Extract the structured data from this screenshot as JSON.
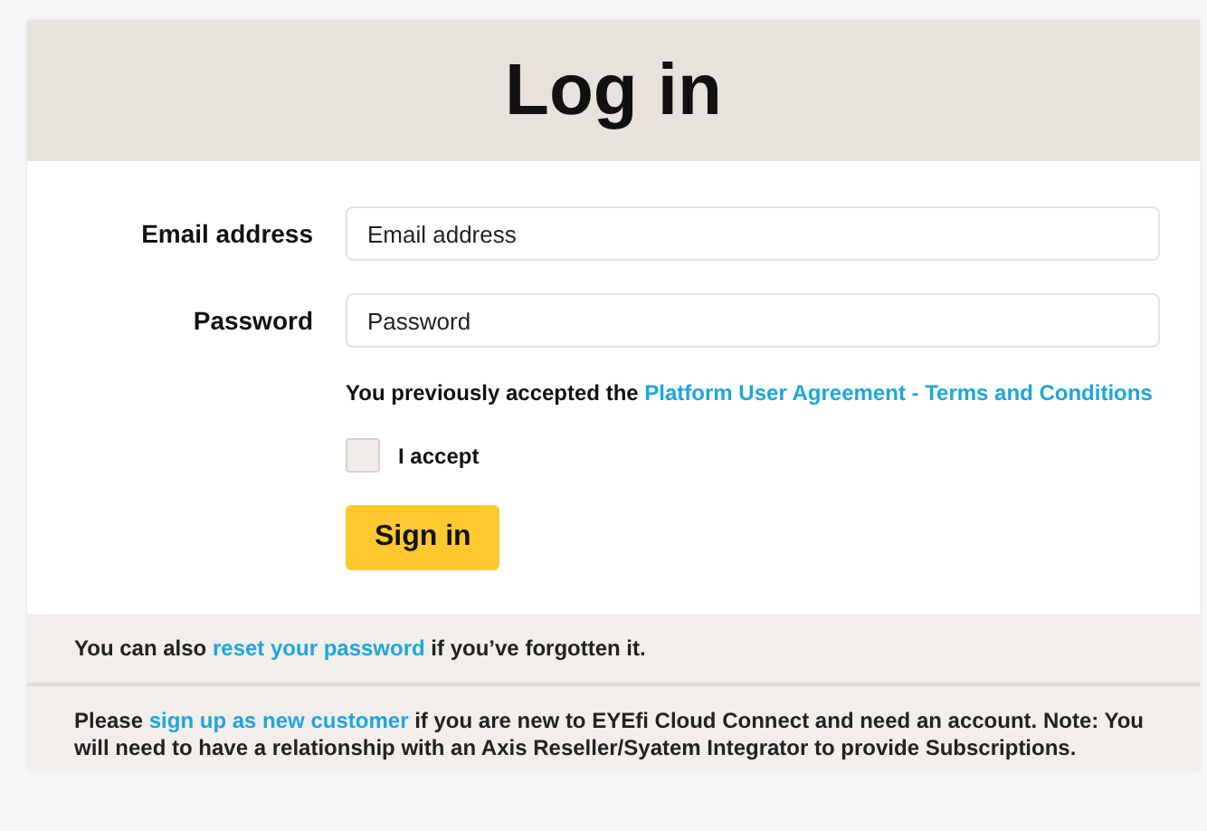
{
  "title": "Log in",
  "fields": [
    {
      "label": "Email address",
      "placeholder": "Email address"
    },
    {
      "label": "Password",
      "placeholder": "Password"
    }
  ],
  "agreement": {
    "before": "You previously accepted the ",
    "link": "Platform User Agreement - Terms and Conditions"
  },
  "accept": {
    "label": "I accept",
    "checked": false
  },
  "submit": "Sign in",
  "notes": [
    {
      "before": "You can also ",
      "link": "reset your password",
      "after": " if you’ve forgotten it."
    },
    {
      "before": "Please ",
      "link": "sign up as new customer",
      "after": " if you are new to EYEfi Cloud Connect and need an account. Note: You will need to have a relationship with an Axis Reseller/Syatem Integrator to provide Subscriptions."
    }
  ]
}
